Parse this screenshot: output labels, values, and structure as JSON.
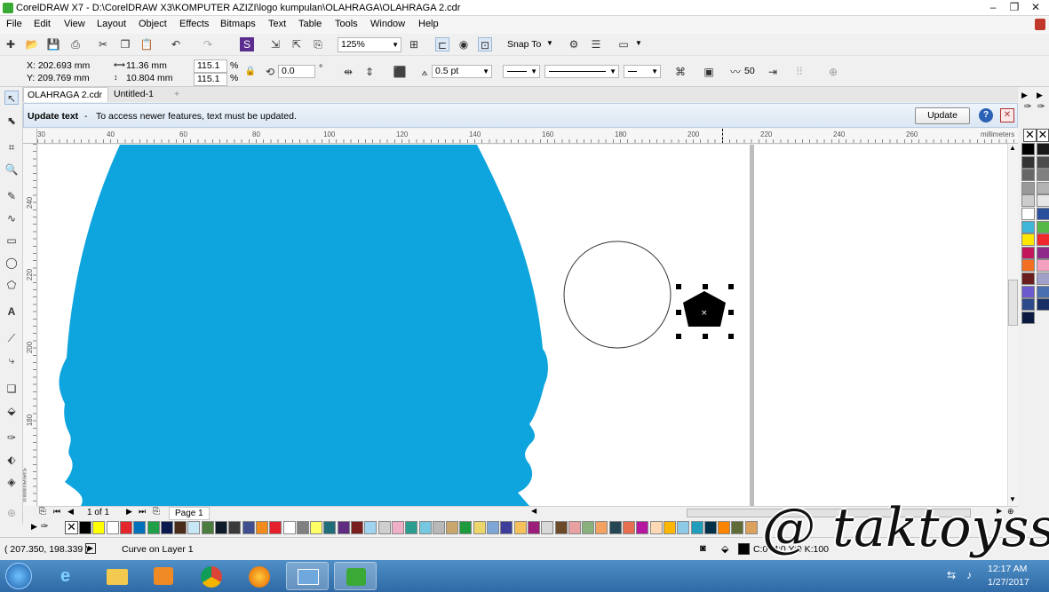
{
  "window": {
    "title": "CorelDRAW X7 - D:\\CorelDRAW X3\\KOMPUTER  AZIZI\\logo kumpulan\\OLAHRAGA\\OLAHRAGA 2.cdr",
    "controls": [
      "–",
      "❐",
      "✕"
    ]
  },
  "menu": [
    "File",
    "Edit",
    "View",
    "Layout",
    "Object",
    "Effects",
    "Bitmaps",
    "Text",
    "Table",
    "Tools",
    "Window",
    "Help"
  ],
  "standard_toolbar": {
    "zoom": "125%",
    "snap_to": "Snap To"
  },
  "property_bar": {
    "x": "X: 202.693 mm",
    "y": "Y: 209.769 mm",
    "width": "11.36 mm",
    "height": "10.804 mm",
    "scale_w": "115.1",
    "scale_h": "115.1",
    "pct1": "%",
    "pct2": "%",
    "rotation": "0.0",
    "degree": "°",
    "outline_width": "0.5 pt",
    "sides": "50"
  },
  "tabs": [
    {
      "label": "OLAHRAGA 2.cdr",
      "active": true
    },
    {
      "label": "Untitled-1",
      "active": false
    }
  ],
  "tab_add": "+",
  "banner": {
    "title": "Update text",
    "sep": "-",
    "message": "To access newer features, text must be updated.",
    "button": "Update",
    "help": "?",
    "close": "✕"
  },
  "ruler": {
    "h_ticks": [
      "30",
      "40",
      "60",
      "80",
      "100",
      "120",
      "140",
      "160",
      "180",
      "200",
      "220",
      "240",
      "260"
    ],
    "units": "millimeters",
    "v_ticks": [
      "240",
      "220",
      "200",
      "180"
    ],
    "v_units": "millimeters"
  },
  "page_nav": {
    "count": "1 of 1",
    "page": "Page 1"
  },
  "status": {
    "coords": "( 207.350, 198.339 )",
    "info": "Curve on Layer 1",
    "color_text": "C:0 M:0 Y:0 K:100"
  },
  "colors": {
    "blue_shape": "#0ea4dd",
    "accent": "#2f6aa6"
  },
  "palette_bottom": [
    "#000000",
    "#ffff00",
    "#ffffff",
    "#e3262c",
    "#0071bb",
    "#1f9f48",
    "#0b1a4e",
    "#4b2c1b",
    "#c7e7f7",
    "#4a7d3f",
    "#0d1b2a",
    "#3a3a3a",
    "#3f4e8f",
    "#f28b1e",
    "#e51f2b",
    "#ffffff",
    "#808080",
    "#ffff66",
    "#1f6d7a",
    "#5f2c82",
    "#7a1f1f",
    "#9fd3ef",
    "#cfcfcf",
    "#efb0c7",
    "#2a9d8f",
    "#76c7e0",
    "#b8b8b8",
    "#c9a66b",
    "#1d9a3b",
    "#ecd66a",
    "#7ea7d8",
    "#3d3d9a",
    "#f6c05a",
    "#9a1e7a",
    "#d8d8d8",
    "#6b4a2a",
    "#e8a0a0",
    "#8ab17d",
    "#f4a261",
    "#264653",
    "#e76f51",
    "#b5179e",
    "#fdd9b5",
    "#ffb703",
    "#8ecae6",
    "#219ebc",
    "#023047",
    "#fb8500",
    "#606c38",
    "#dda15e"
  ],
  "palette_right": [
    "#000000",
    "#1a1a1a",
    "#333333",
    "#4d4d4d",
    "#666666",
    "#808080",
    "#999999",
    "#b3b3b3",
    "#cccccc",
    "#e6e6e6",
    "#ffffff",
    "#2a4f9c",
    "#3fb6d8",
    "#55b847",
    "#ffe600",
    "#f0272d",
    "#c2185b",
    "#8e2a8a",
    "#f36f21",
    "#f4a0c0",
    "#6b1e1e",
    "#a0a0c8",
    "#6a5acd",
    "#4a6fb0",
    "#2c4a8a",
    "#1a2f66",
    "#0a1a40"
  ],
  "taskbar": {
    "time": "12:17 AM",
    "date": "1/27/2017"
  },
  "watermark": "@ taktoyss"
}
